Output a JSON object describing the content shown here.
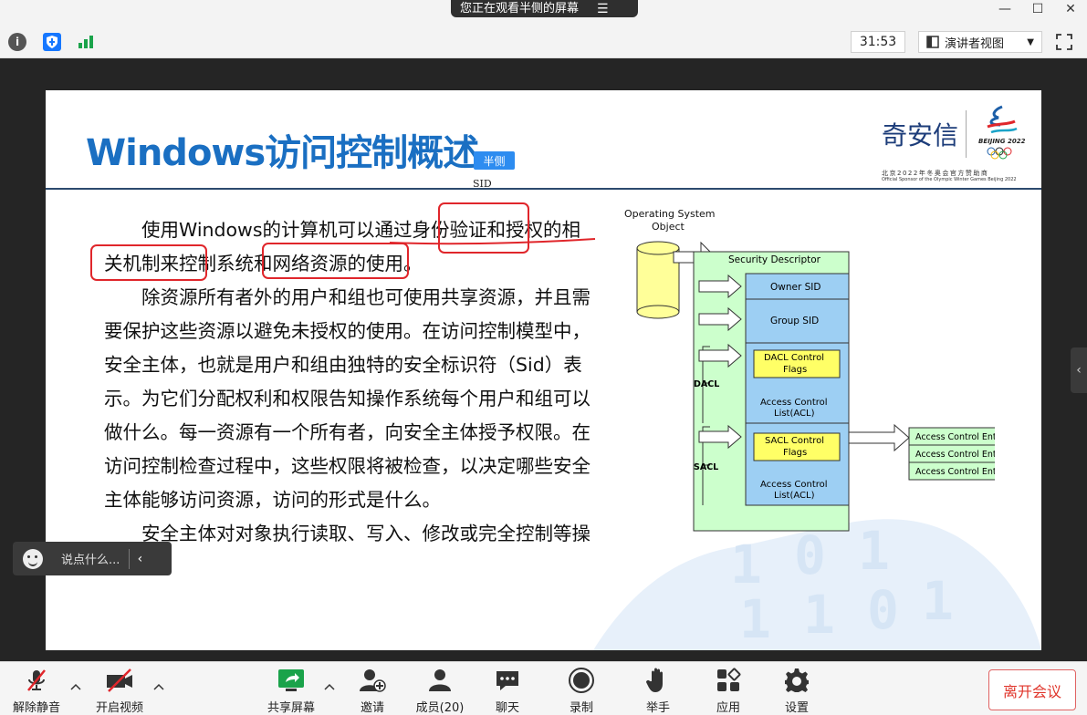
{
  "window": {
    "share_notice": "您正在观看半侧的屏幕",
    "minimize": "—",
    "maximize": "☐",
    "close": "✕"
  },
  "infobar": {
    "timer": "31:53",
    "view_mode": "演讲者视图"
  },
  "slide": {
    "title": "Windows访问控制概述",
    "logo_text": "奇安信",
    "logo_olympic_text": "BEIJING 2022",
    "logo_sponsor_cn": "北京2022年冬奥会官方赞助商",
    "logo_sponsor_en": "Official Sponsor of the Olympic Winter Games Beijing 2022",
    "tooltip_name": "半侧",
    "cursor_label": "SID",
    "paragraphs": [
      "使用Windows的计算机可以通过身份验证和授权的相关机制来控制系统和网络资源的使用。",
      "除资源所有者外的用户和组也可使用共享资源，并且需要保护这些资源以避免未授权的使用。在访问控制模型中，安全主体，也就是用户和组由独特的安全标识符（Sid）表示。为它们分配权利和权限告知操作系统每个用户和组可以做什么。每一资源有一个所有者，向安全主体授予权限。在访问控制检查过程中，这些权限将被检查，以决定哪些安全主体能够访问资源，访问的形式是什么。",
      "安全主体对对象执行读取、写入、修改或完全控制等操作。"
    ],
    "diagram": {
      "os_object_label_1": "Operating System",
      "os_object_label_2": "Object",
      "security_descriptor": "Security Descriptor",
      "owner_sid": "Owner SID",
      "group_sid": "Group SID",
      "dacl_flags_1": "DACL Control",
      "dacl_flags_2": "Flags",
      "dacl_acl_1": "Access Control",
      "dacl_acl_2": "List(ACL)",
      "sacl_flags_1": "SACL Control",
      "sacl_flags_2": "Flags",
      "sacl_acl_1": "Access Control",
      "sacl_acl_2": "List(ACL)",
      "dacl_label": "DACL",
      "sacl_label": "SACL",
      "ace_entries": [
        "Access Control Entry",
        "Access Control Entry",
        "Access Control Entry"
      ]
    }
  },
  "chat": {
    "placeholder": "说点什么..."
  },
  "toolbar": {
    "mute": "解除静音",
    "video": "开启视频",
    "share": "共享屏幕",
    "invite": "邀请",
    "members": "成员(20)",
    "chat": "聊天",
    "record": "录制",
    "raise_hand": "举手",
    "apps": "应用",
    "settings": "设置",
    "leave": "离开会议"
  },
  "colors": {
    "title_blue": "#1a6fc2",
    "annotation_red": "#e0262b",
    "diagram_green": "#ccffcc",
    "diagram_blue": "#9dcff3",
    "diagram_yellow": "#ffff66",
    "leave_red": "#e0352b",
    "share_green": "#1aa34a"
  }
}
